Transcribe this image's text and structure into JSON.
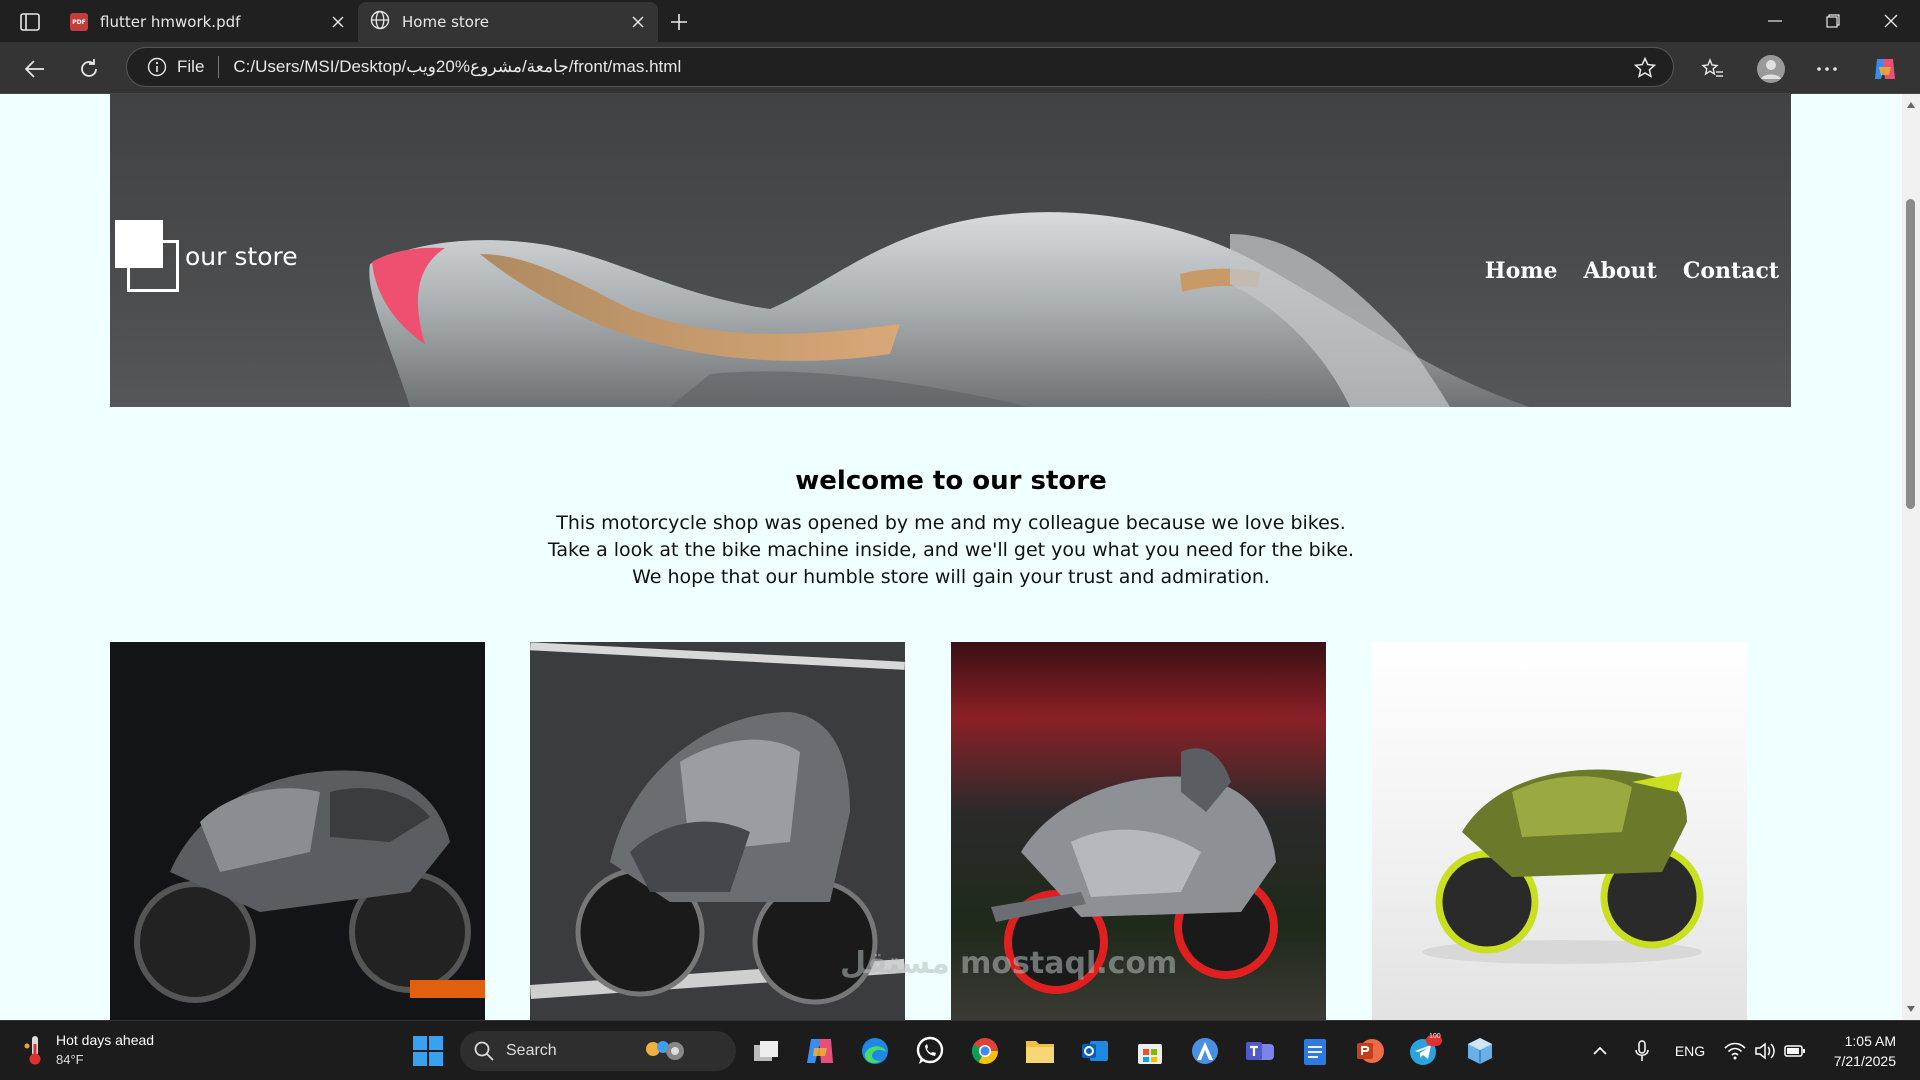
{
  "browser": {
    "tabs": [
      {
        "label": "flutter hmwork.pdf",
        "active": false
      },
      {
        "label": "Home store",
        "active": true
      }
    ],
    "address": {
      "scheme_label": "File",
      "url": "C:/Users/MSI/Desktop/جامعة/مشروع%20ويب/front/mas.html"
    }
  },
  "page": {
    "logo_text": "our store",
    "nav": [
      "Home",
      "About",
      "Contact"
    ],
    "welcome_title": "welcome to our store",
    "welcome_lines": [
      "This motorcycle shop was opened by me and my colleague because we love bikes.",
      "Take a look at the bike machine inside, and we'll get you what you need for the bike.",
      "We hope that our humble store will gain your trust and admiration."
    ],
    "gallery": [
      {
        "name": "black-sport-bike",
        "accent": "#e06010"
      },
      {
        "name": "grey-superbike",
        "accent": "#9a9a9a"
      },
      {
        "name": "silver-red-bike",
        "accent": "#e02020"
      },
      {
        "name": "green-electric-bike",
        "accent": "#c8e020"
      }
    ],
    "watermark": "مستقل mostaql.com"
  },
  "taskbar": {
    "weather_title": "Hot days ahead",
    "weather_temp": "84°F",
    "search_label": "Search",
    "language": "ENG",
    "time": "1:05 AM",
    "date": "7/21/2025",
    "notification_badge": "100"
  },
  "colors": {
    "page_background": "#f0ffff",
    "hero_background": "#4a4c4e",
    "chrome_dark": "#202020",
    "chrome_toolbar": "#343434"
  }
}
